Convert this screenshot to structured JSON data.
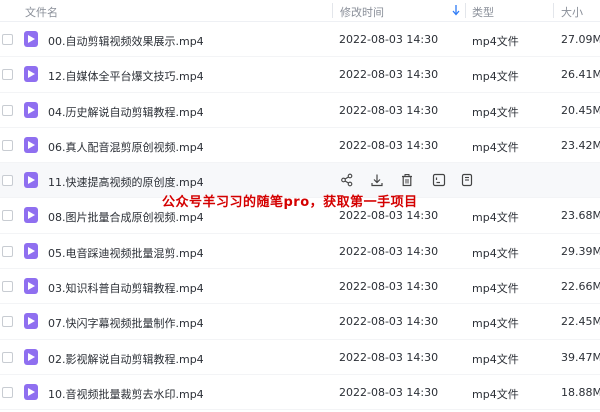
{
  "header": {
    "name_label": "文件名",
    "time_label": "修改时间",
    "type_label": "类型",
    "size_label": "大小"
  },
  "files": [
    {
      "name": "00.自动剪辑视频效果展示.mp4",
      "time": "2022-08-03 14:30",
      "type": "mp4文件",
      "size": "27.09M"
    },
    {
      "name": "12.自媒体全平台爆文技巧.mp4",
      "time": "2022-08-03 14:30",
      "type": "mp4文件",
      "size": "26.41M"
    },
    {
      "name": "04.历史解说自动剪辑教程.mp4",
      "time": "2022-08-03 14:30",
      "type": "mp4文件",
      "size": "20.45M"
    },
    {
      "name": "06.真人配音混剪原创视频.mp4",
      "time": "2022-08-03 14:30",
      "type": "mp4文件",
      "size": "23.42M"
    },
    {
      "name": "11.快速提高视频的原创度.mp4",
      "time": "",
      "type": "",
      "size": ""
    },
    {
      "name": "08.图片批量合成原创视频.mp4",
      "time": "2022-08-03 14:30",
      "type": "mp4文件",
      "size": "23.68M"
    },
    {
      "name": "05.电音踩迪视频批量混剪.mp4",
      "time": "2022-08-03 14:30",
      "type": "mp4文件",
      "size": "29.39M"
    },
    {
      "name": "03.知识科普自动剪辑教程.mp4",
      "time": "2022-08-03 14:30",
      "type": "mp4文件",
      "size": "22.66M"
    },
    {
      "name": "07.快闪字幕视频批量制作.mp4",
      "time": "2022-08-03 14:30",
      "type": "mp4文件",
      "size": "22.45M"
    },
    {
      "name": "02.影视解说自动剪辑教程.mp4",
      "time": "2022-08-03 14:30",
      "type": "mp4文件",
      "size": "39.47M"
    },
    {
      "name": "10.音视频批量裁剪去水印.mp4",
      "time": "2022-08-03 14:30",
      "type": "mp4文件",
      "size": "18.88M"
    }
  ],
  "hover_actions": [
    "share-icon",
    "download-icon",
    "delete-icon",
    "rename-icon",
    "copy-icon"
  ],
  "watermark": "公众号羊习习的随笔pro，获取第一手项目",
  "colors": {
    "file_icon": "#8f6ff0",
    "watermark": "#d40000",
    "sort_arrow": "#2f7cf6"
  }
}
